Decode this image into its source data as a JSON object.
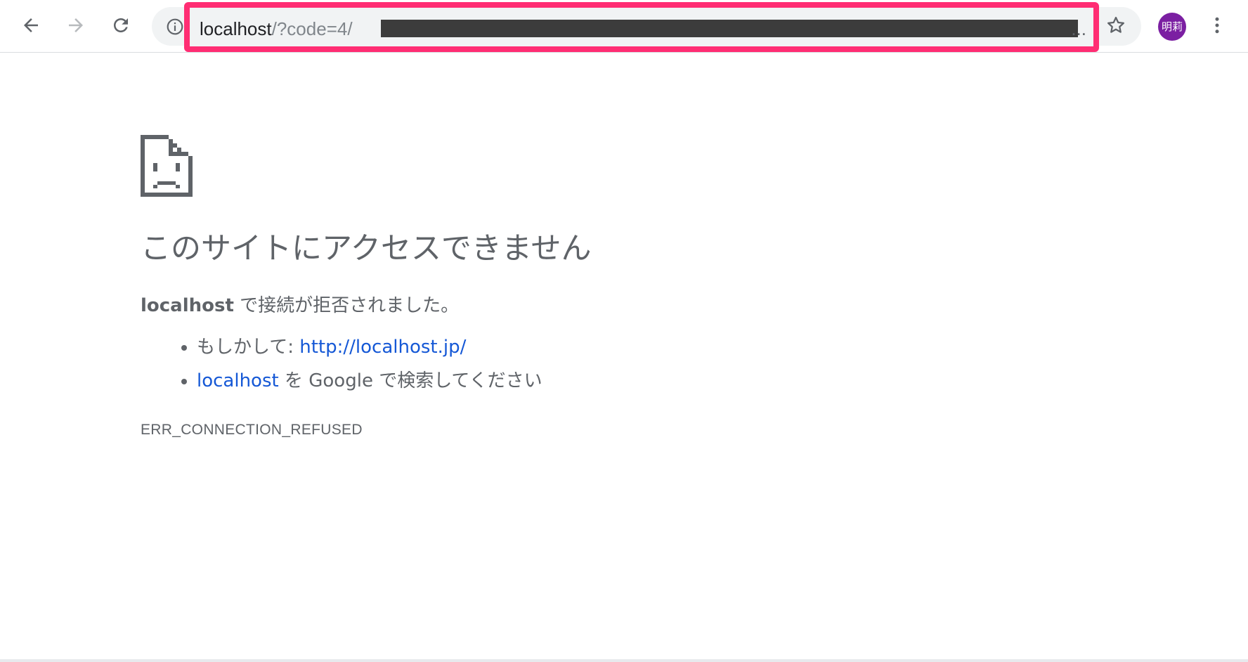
{
  "browser": {
    "url": {
      "host": "localhost",
      "rest": "/?code=4/",
      "ellipsis": "..."
    },
    "profile_avatar": "明莉",
    "icons": {
      "back": "arrow-left-icon",
      "forward": "arrow-right-icon",
      "reload": "reload-icon",
      "info": "info-icon",
      "bookmark": "star-icon",
      "menu": "vertical-dots-icon"
    },
    "highlight_color": "#ff2d73"
  },
  "error_page": {
    "icon": "sad-page-icon",
    "heading": "このサイトにアクセスできません",
    "message": {
      "host": "localhost",
      "text": " で接続が拒否されました。"
    },
    "suggestions": [
      {
        "prefix": "もしかして: ",
        "link": "http://localhost.jp/",
        "suffix": ""
      },
      {
        "prefix": "",
        "link": "localhost",
        "suffix": " を Google で検索してください"
      }
    ],
    "error_code": "ERR_CONNECTION_REFUSED"
  }
}
